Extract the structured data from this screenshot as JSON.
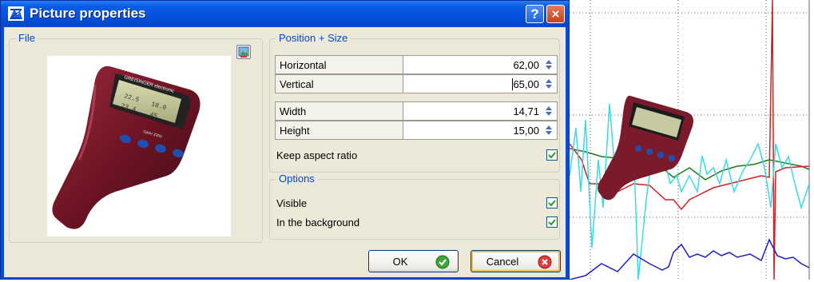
{
  "window": {
    "title": "Picture properties",
    "help_glyph": "?",
    "close_glyph": "×"
  },
  "file_group": {
    "title": "File",
    "device": {
      "brand": "GREISINGER electronic",
      "model": "GMH 3350",
      "display_lines": [
        "22.5",
        "18.0",
        "23.4",
        "45"
      ]
    }
  },
  "position_size": {
    "title": "Position + Size",
    "horizontal": {
      "label": "Horizontal",
      "value": "62,00"
    },
    "vertical": {
      "label": "Vertical",
      "value": "65,00"
    },
    "width": {
      "label": "Width",
      "value": "14,71"
    },
    "height": {
      "label": "Height",
      "value": "15,00"
    },
    "keep_aspect": {
      "label": "Keep aspect ratio",
      "checked": true
    }
  },
  "options": {
    "title": "Options",
    "visible": {
      "label": "Visible",
      "checked": true
    },
    "background": {
      "label": "In the background",
      "checked": true
    }
  },
  "buttons": {
    "ok": "OK",
    "cancel": "Cancel"
  },
  "colors": {
    "titlebar": "#0451de",
    "group_title": "#0046d5",
    "check": "#21a121",
    "cancel_icon": "#e03b3b",
    "series_cyan": "#3ad9e8",
    "series_red": "#d22020",
    "series_green": "#1c7a1c",
    "series_blue": "#1e1ed0"
  }
}
